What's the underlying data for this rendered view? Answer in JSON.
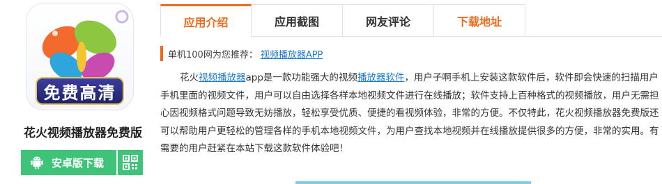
{
  "app": {
    "icon_badge_text": "免费高清",
    "name": "花火视频播放器免费版",
    "download_label": "安卓版下载"
  },
  "tabs": [
    {
      "label": "应用介绍",
      "active": true
    },
    {
      "label": "应用截图",
      "active": false
    },
    {
      "label": "网友评论",
      "active": false
    },
    {
      "label": "下载地址",
      "active": false,
      "highlight": true
    }
  ],
  "recommend": {
    "label": "单机100网为您推荐：",
    "link": "视频播放器APP"
  },
  "description": {
    "p1_start": "花火",
    "link1": "视频播放器",
    "p1_mid": "app是一款功能强大的视频",
    "link2": "播放器软件",
    "p1_end": "，用户子啊手机上安装这款软件后，软件即会快速的扫描用户手机里面的视频文件，用户可以自由选择各样本地视频文件进行在线播放；软件支持上百种格式的视频播放，用户无需担心因视频格式问题导致无妨播放，轻松享受优质、便捷的看视频体验，非常的方便。不仅特此，花火视频播放器免费版还可以帮助用户更轻松的管理各样的手机本地视频文件，为用户查找本地视频并在线播放提供很多的方便，非常的实用。有需要的用户赶紧在本站下载这款软件体验吧！"
  },
  "colors": {
    "accent_orange": "#ee6a1c",
    "download_green": "#3fc378",
    "link_blue": "#1d7bd8"
  }
}
